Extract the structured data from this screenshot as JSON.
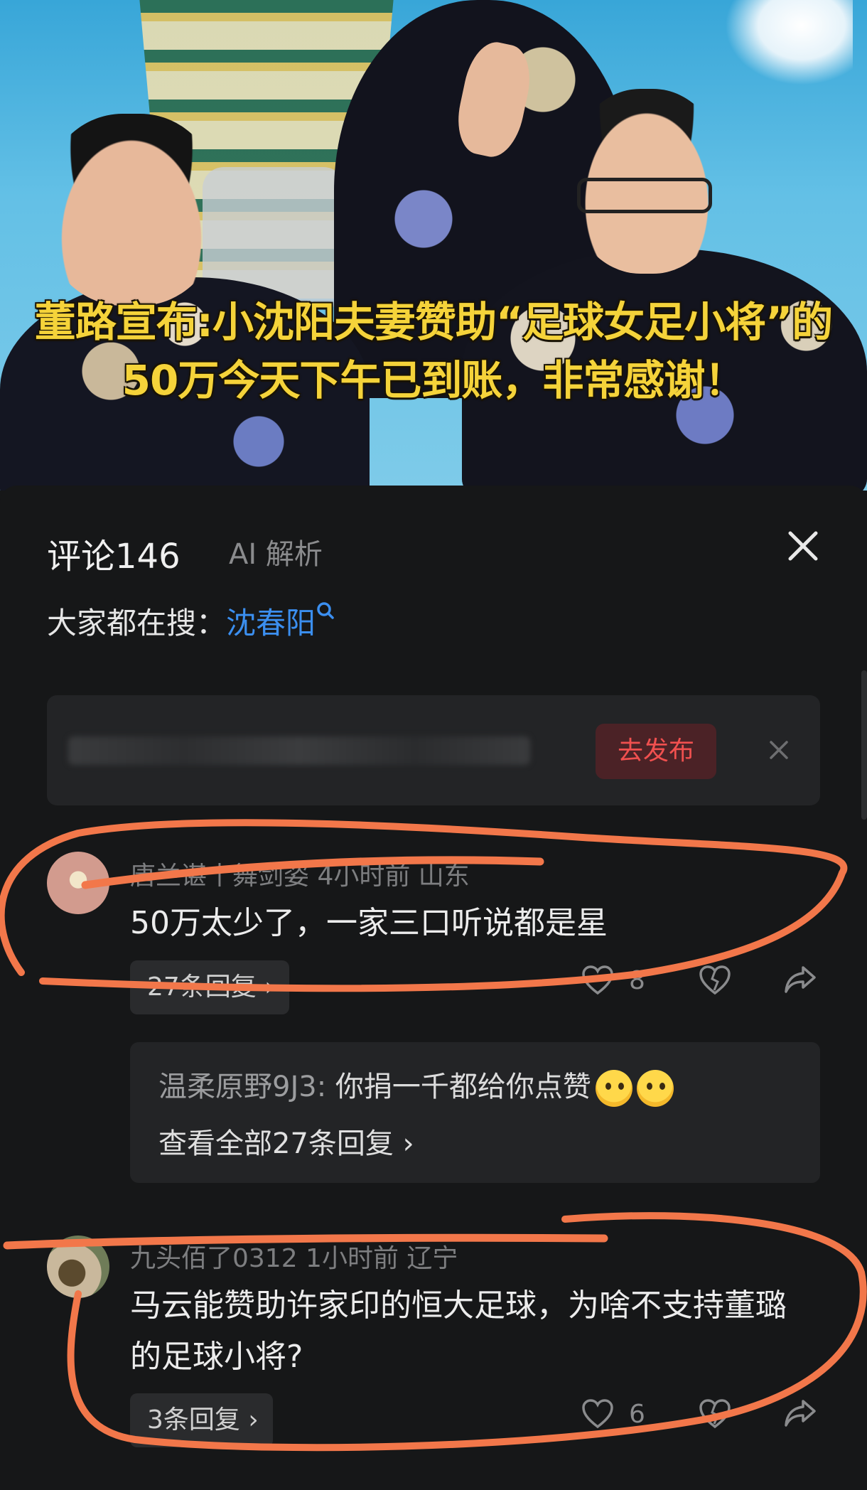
{
  "video": {
    "caption_line1": "董路宣布:小沈阳夫妻赞助“足球女足小将”的",
    "caption_line2": "50万今天下午已到账，非常感谢！"
  },
  "comments_panel": {
    "title": "评论146",
    "ai_label": "AI 解析",
    "close_icon": "close-icon",
    "search_prefix": "大家都在搜：",
    "search_term": "沈春阳",
    "compose": {
      "publish_label": "去发布"
    },
    "comments": [
      {
        "meta": "唐兰谌丨舞剑姿   4小时前   山东",
        "text": "50万太少了，一家三口听说都是星",
        "reply_chip": "27条回复 ›",
        "likes": "8",
        "thread": {
          "user": "温柔原野9J3:",
          "text": " 你捐一千都给你点赞",
          "more": "查看全部27条回复 ›"
        }
      },
      {
        "meta": "九头佰了0312   1小时前   辽宁",
        "text": "马云能赞助许家印的恒大足球，为啥不支持董璐的足球小将?",
        "reply_chip": "3条回复 ›",
        "likes": "6"
      }
    ]
  },
  "colors": {
    "accent_blue": "#3b8ff0",
    "publish_red": "#f0504f",
    "caption_yellow": "#f5d33a",
    "annotation_orange": "#f2774a"
  }
}
